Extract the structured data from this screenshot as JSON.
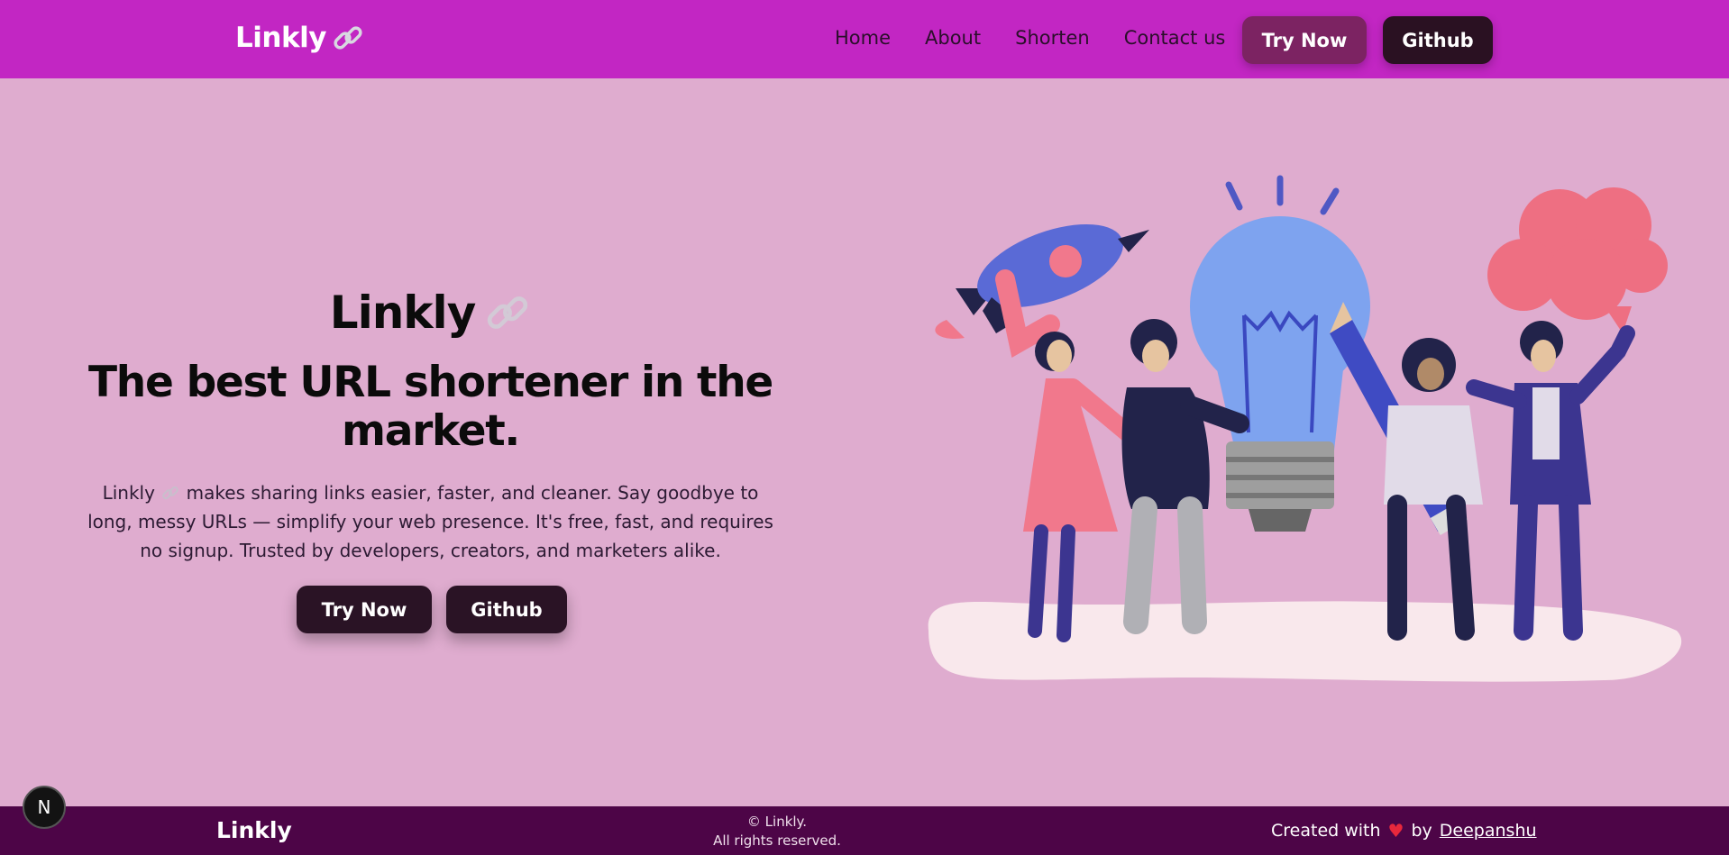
{
  "nav": {
    "brand": "Linkly",
    "brand_icon": "link-icon",
    "links": [
      "Home",
      "About",
      "Shorten",
      "Contact us"
    ],
    "try_label": "Try Now",
    "github_label": "Github"
  },
  "hero": {
    "title": "Linkly",
    "subtitle": "The best URL shortener in the market.",
    "desc_start": "Linkly",
    "desc_rest": " makes sharing links easier, faster, and cleaner. Say goodbye to long, messy URLs — simplify your web presence. It's free, fast, and requires no signup. Trusted by developers, creators, and marketers alike.",
    "try_label": "Try Now",
    "github_label": "Github"
  },
  "footer": {
    "brand": "Linkly",
    "copy_line1": "© Linkly.",
    "copy_line2": "All rights reserved.",
    "created_with": "Created with",
    "by": "by",
    "author": "Deepanshu"
  },
  "badge": {
    "letter": "N"
  },
  "colors": {
    "nav_bg": "#c226c3",
    "page_bg": "#dfaccf",
    "footer_bg": "#4d0547",
    "button_dark": "#2a1325",
    "button_try_nav": "#7c2362"
  }
}
